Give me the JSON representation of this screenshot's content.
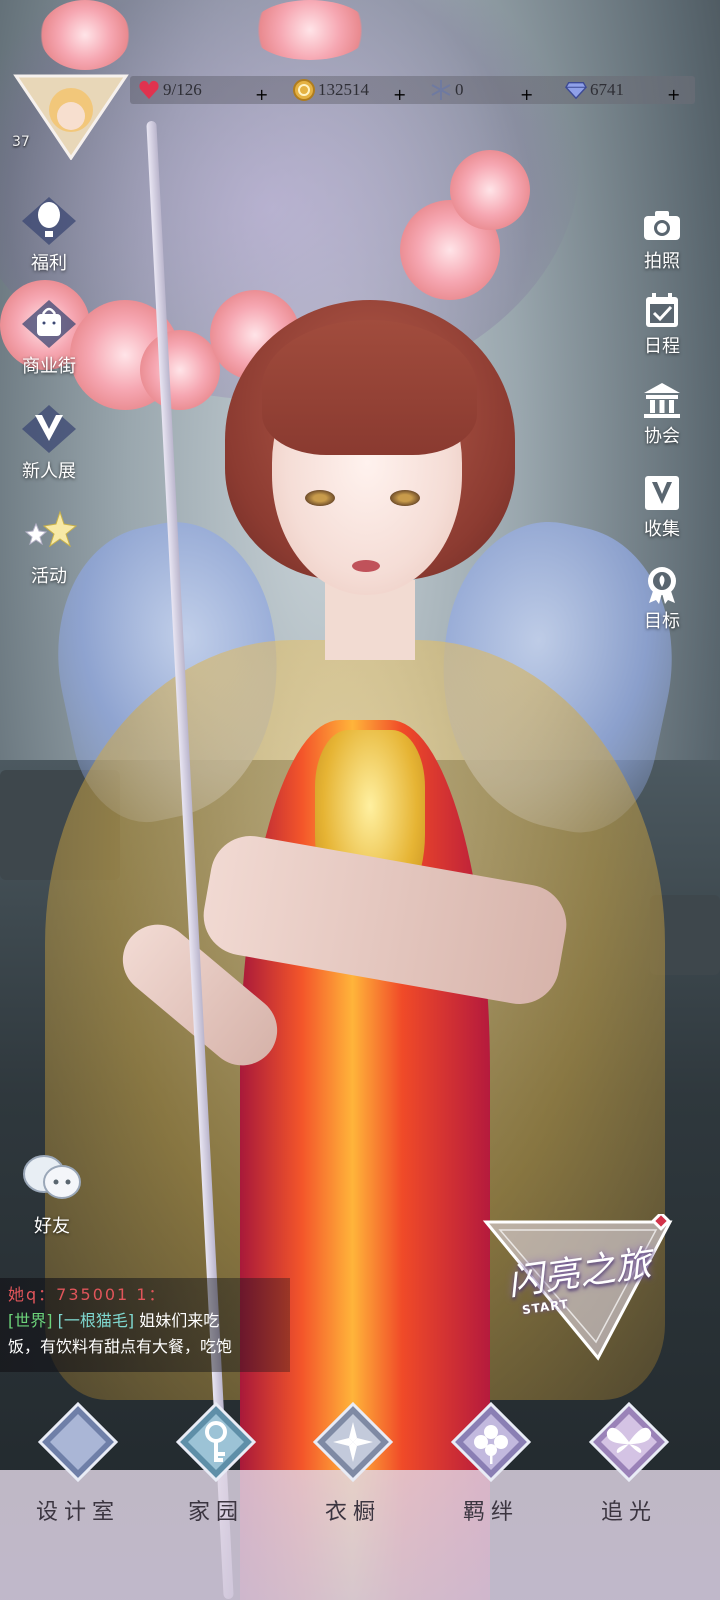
{
  "player": {
    "level": "37"
  },
  "resources": [
    {
      "icon": "heart-gem-icon",
      "value": "9/126"
    },
    {
      "icon": "gold-coin-icon",
      "value": "132514"
    },
    {
      "icon": "snowflake-icon",
      "value": "0"
    },
    {
      "icon": "diamond-icon",
      "value": "6741"
    }
  ],
  "left_menu": [
    {
      "icon": "hot-air-balloon-icon",
      "label": "福利"
    },
    {
      "icon": "shopping-bag-icon",
      "label": "商业街"
    },
    {
      "icon": "v-crown-icon",
      "label": "新人展"
    },
    {
      "icon": "stars-icon",
      "label": "活动"
    }
  ],
  "right_menu": [
    {
      "icon": "camera-icon",
      "label": "拍照"
    },
    {
      "icon": "calendar-check-icon",
      "label": "日程"
    },
    {
      "icon": "building-icon",
      "label": "协会"
    },
    {
      "icon": "v-badge-icon",
      "label": "收集"
    },
    {
      "icon": "medal-icon",
      "label": "目标"
    }
  ],
  "friends": {
    "icon": "chat-bubbles-icon",
    "label": "好友"
  },
  "chat": {
    "line1": "她q：735001 1：",
    "channel": "[世界]",
    "sender": "[一根猫毛]",
    "message_part1": "姐妹们来吃",
    "message_part2": "饭，有饮料有甜点有大餐，吃饱"
  },
  "event_badge": {
    "title": "闪亮之旅",
    "subtitle": "START"
  },
  "bottom_nav": [
    {
      "icon": "moon-crest-icon",
      "label": "设计室"
    },
    {
      "icon": "key-icon",
      "label": "家园"
    },
    {
      "icon": "crystal-flower-icon",
      "label": "衣橱"
    },
    {
      "icon": "clover-icon",
      "label": "羁绊"
    },
    {
      "icon": "butterfly-icon",
      "label": "追光"
    }
  ],
  "colors": {
    "chat_world": "#6cd37a",
    "chat_name": "#7fd8d0",
    "chat_qq": "#e0555a",
    "plus": "#2c4a2c"
  }
}
